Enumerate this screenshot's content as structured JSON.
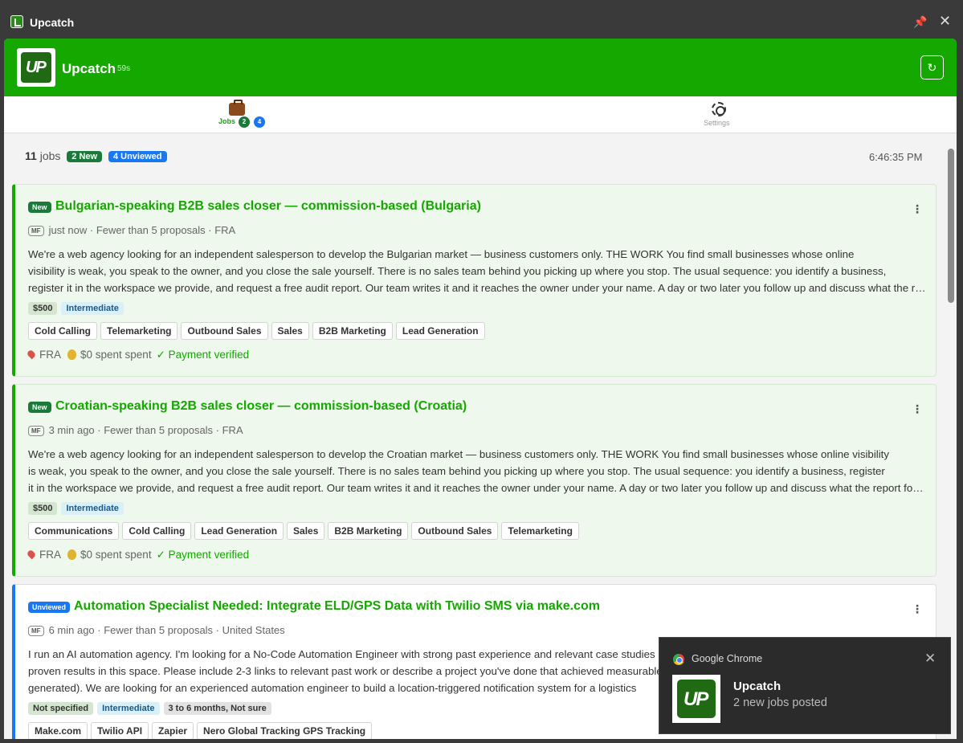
{
  "window": {
    "title": "Upcatch",
    "pin_icon": "pin-icon",
    "close_icon": "close-icon"
  },
  "header": {
    "brand": "Upcatch",
    "age": "59s",
    "refresh_icon": "refresh-icon",
    "accent": "#14a800"
  },
  "tabs": {
    "jobs": {
      "label": "Jobs",
      "new_count": "2",
      "unviewed_count": "4"
    },
    "settings": {
      "label": "Settings"
    }
  },
  "summary": {
    "count": "11",
    "count_label": "jobs",
    "new_badge": "2 New",
    "unviewed_badge": "4 Unviewed",
    "time": "6:46:35 PM"
  },
  "jobs": [
    {
      "status": "New",
      "title": "Bulgarian-speaking B2B sales closer — commission-based (Bulgaria)",
      "client_tag": "MF",
      "posted": "just now",
      "proposals": " · Fewer than 5 proposals",
      "country_meta": " · FRA",
      "desc_lines": [
        "We're a web agency looking for an independent salesperson to develop the Bulgarian market — business customers only. THE WORK You find small businesses whose online",
        "visibility is weak, you speak to the owner, and you close the sale yourself. There is no sales team behind you picking up where you stop. The usual sequence: you identify a business,",
        "register it in the workspace we provide, and request a free audit report. Our team writes it and it reaches the owner under your name. A day or two later you follow up and discuss what the report found..."
      ],
      "budget": "$500",
      "level": "Intermediate",
      "skills": [
        "Cold Calling",
        "Telemarketing",
        "Outbound Sales",
        "Sales",
        "B2B Marketing",
        "Lead Generation"
      ],
      "country": "FRA",
      "spent": "$0 spent spent",
      "payment": "✓ Payment verified"
    },
    {
      "status": "New",
      "title": "Croatian-speaking B2B sales closer — commission-based (Croatia)",
      "client_tag": "MF",
      "posted": "3 min ago",
      "proposals": " · Fewer than 5 proposals",
      "country_meta": " · FRA",
      "desc_lines": [
        "We're a web agency looking for an independent salesperson to develop the Croatian market — business customers only. THE WORK You find small businesses whose online visibility",
        "is weak, you speak to the owner, and you close the sale yourself. There is no sales team behind you picking up where you stop. The usual sequence: you identify a business, register",
        "it in the workspace we provide, and request a free audit report. Our team writes it and it reaches the owner under your name. A day or two later you follow up and discuss what the report found..."
      ],
      "budget": "$500",
      "level": "Intermediate",
      "skills": [
        "Communications",
        "Cold Calling",
        "Lead Generation",
        "Sales",
        "B2B Marketing",
        "Outbound Sales",
        "Telemarketing"
      ],
      "country": "FRA",
      "spent": "$0 spent spent",
      "payment": "✓ Payment verified"
    },
    {
      "status": "Unviewed",
      "title": "Automation Specialist Needed: Integrate ELD/GPS Data with Twilio SMS via make.com",
      "client_tag": "MF",
      "posted": "6 min ago",
      "proposals": " · Fewer than 5 proposals",
      "country_meta": " · United States",
      "desc_lines": [
        "I run an AI automation agency. I'm looking for a No-Code Automation Engineer with strong past experience and relevant case studies",
        "proven results in this space. Please include 2-3 links to relevant past work or describe a project you've done that achieved measurable",
        "generated). We are looking for an experienced automation engineer to build a location-triggered notification system for a logistics"
      ],
      "budget": "Not specified",
      "level": "Intermediate",
      "duration": "3 to 6 months, Not sure",
      "skills": [
        "Make.com",
        "Twilio API",
        "Zapier",
        "Nero Global Tracking GPS Tracking"
      ]
    }
  ],
  "notification": {
    "source": "Google Chrome",
    "title": "Upcatch",
    "message": "2 new jobs posted",
    "close_icon": "close-icon"
  }
}
